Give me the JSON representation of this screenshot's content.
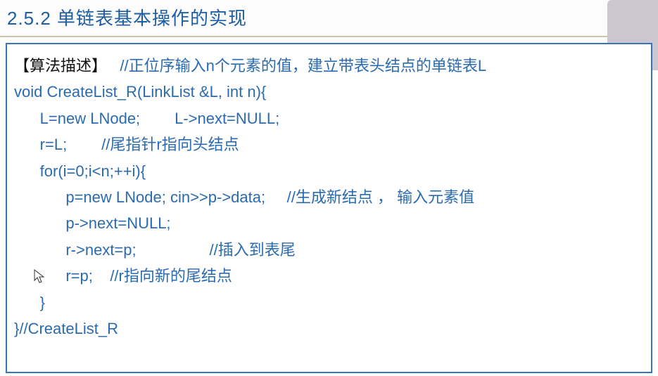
{
  "heading": "2.5.2 单链表基本操作的实现",
  "corner_label": "",
  "code": {
    "line1_black": "【算法描述】",
    "line1_comment": "   //正位序输入n个元素的值，建立带表头结点的单链表L",
    "line2": "void CreateList_R(LinkList &L, int n){",
    "line3": "      L=new LNode;        L->next=NULL;",
    "line4": "      r=L;        //尾指针r指向头结点",
    "line5": "      for(i=0;i<n;++i){",
    "line6": "            p=new LNode; cin>>p->data;     //生成新结点 ， 输入元素值",
    "line7": "            p->next=NULL;",
    "line8": "            r->next=p;                 //插入到表尾",
    "line9": "            r=p;    //r指向新的尾结点",
    "line10": "      }",
    "line11": "}//CreateList_R"
  }
}
